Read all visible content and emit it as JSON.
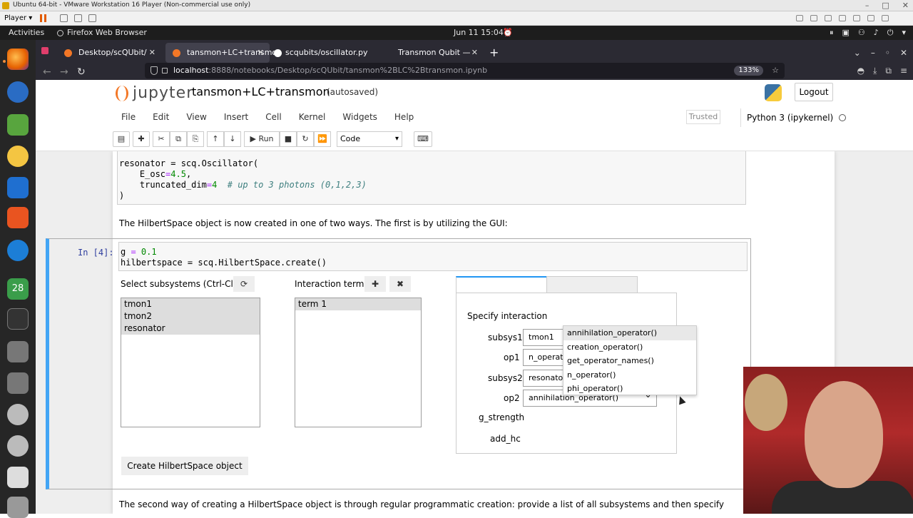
{
  "vm": {
    "title": "Ubuntu 64-bit - VMware Workstation 16 Player (Non-commercial use only)",
    "player_label": "Player ▾"
  },
  "ubuntu_bar": {
    "activities": "Activities",
    "app": "Firefox Web Browser",
    "clock": "Jun 11  15:04"
  },
  "dock": {
    "calendar_day": "28"
  },
  "browser": {
    "tabs": [
      "Desktop/scQUbit/",
      "tansmon+LC+transmon",
      "scqubits/oscillator.py at",
      "Transmon Qubit — scqub"
    ],
    "url_host": "localhost",
    "url_path": ":8888/notebooks/Desktop/scQUbit/tansmon%2BLC%2Btransmon.ipynb",
    "zoom": "133%"
  },
  "jupyter": {
    "logo": "jupyter",
    "notebook_title": "tansmon+LC+transmon",
    "autosave": "(autosaved)",
    "logout": "Logout",
    "menu": [
      "File",
      "Edit",
      "View",
      "Insert",
      "Cell",
      "Kernel",
      "Widgets",
      "Help"
    ],
    "trusted": "Trusted",
    "kernel": "Python 3 (ipykernel)",
    "run_label": "Run",
    "cell_type": "Code"
  },
  "cell1": {
    "l1a": "resonator",
    "l1b": " = scq.Oscillator(",
    "l2a": "    E_osc",
    "l2b": "=",
    "l2c": "4.5",
    "l2d": ",",
    "l3a": "    truncated_dim",
    "l3b": "=",
    "l3c": "4",
    "l3d": "  # up to 3 photons (0,1,2,3)",
    "l4": ")"
  },
  "markdown1": "The HilbertSpace object is now created in one of two ways. The first is by utilizing the GUI:",
  "cell2": {
    "prompt": "In [4]:",
    "l1a": "g",
    "l1b": " = ",
    "l1c": "0.1",
    "l2a": "hilbertspace",
    "l2b": " = scq.HilbertSpace.create()"
  },
  "widget": {
    "subsys_label": "Select subsystems (Ctrl-Click)",
    "subsystems": [
      "tmon1",
      "tmon2",
      "resonator"
    ],
    "interaction_label": "Interaction term(s)",
    "terms": [
      "term 1"
    ],
    "specify_label": "Specify interaction",
    "fields": [
      {
        "label": "subsys1",
        "value": "tmon1"
      },
      {
        "label": "op1",
        "value": "n_operator()"
      },
      {
        "label": "subsys2",
        "value": "resonator"
      },
      {
        "label": "op2",
        "value": "annihilation_operator()"
      }
    ],
    "g_strength_label": "g_strength",
    "add_hc_label": "add_hc",
    "dropdown_options": [
      "annihilation_operator()",
      "creation_operator()",
      "get_operator_names()",
      "n_operator()",
      "phi_operator()"
    ],
    "create_button": "Create HilbertSpace object"
  },
  "markdown2": "The second way of creating a HilbertSpace object is through regular programmatic creation: provide a list of all subsystems and then specify"
}
